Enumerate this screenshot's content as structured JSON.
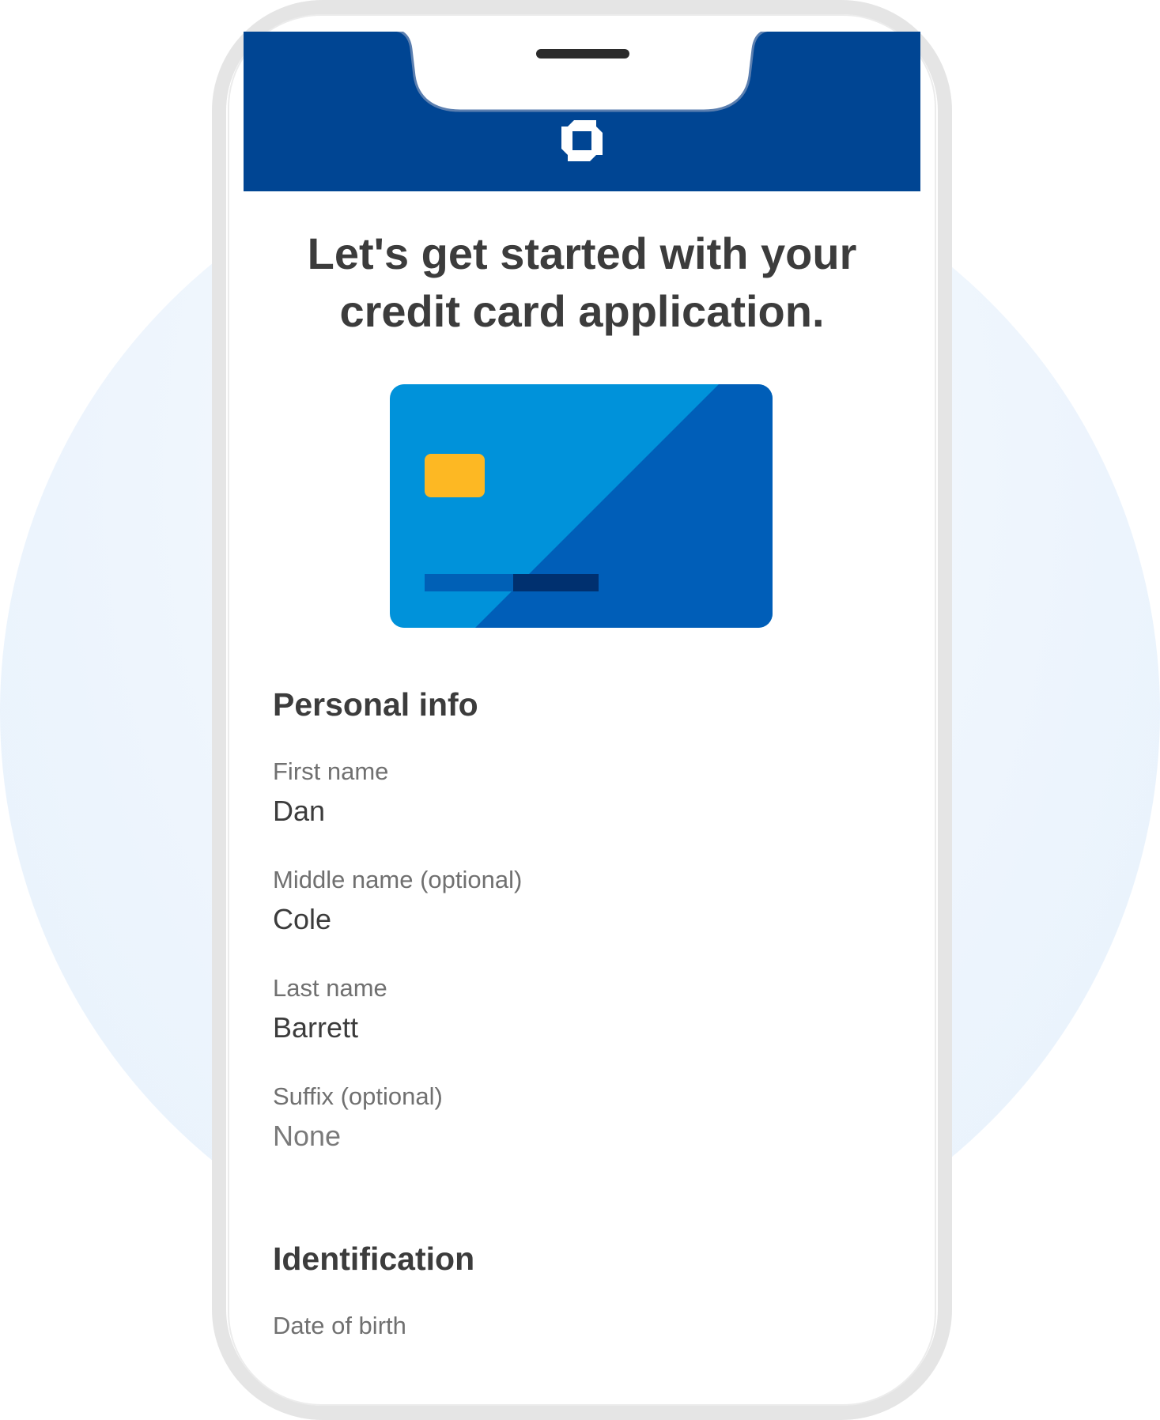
{
  "header": {
    "logo_icon": "chase-octagon-logo",
    "background_color": "#004593"
  },
  "main": {
    "title": "Let's get started with your credit card application."
  },
  "card_illustration": {
    "card_color": "#0092da",
    "card_shade_color": "#005eb8",
    "chip_color": "#fdb823"
  },
  "personal_info": {
    "heading": "Personal info",
    "fields": [
      {
        "label": "First name",
        "value": "Dan"
      },
      {
        "label": "Middle name (optional)",
        "value": "Cole"
      },
      {
        "label": "Last name",
        "value": "Barrett"
      },
      {
        "label": "Suffix (optional)",
        "value": "None"
      }
    ]
  },
  "identification": {
    "heading": "Identification",
    "fields": [
      {
        "label": "Date of birth"
      }
    ]
  }
}
